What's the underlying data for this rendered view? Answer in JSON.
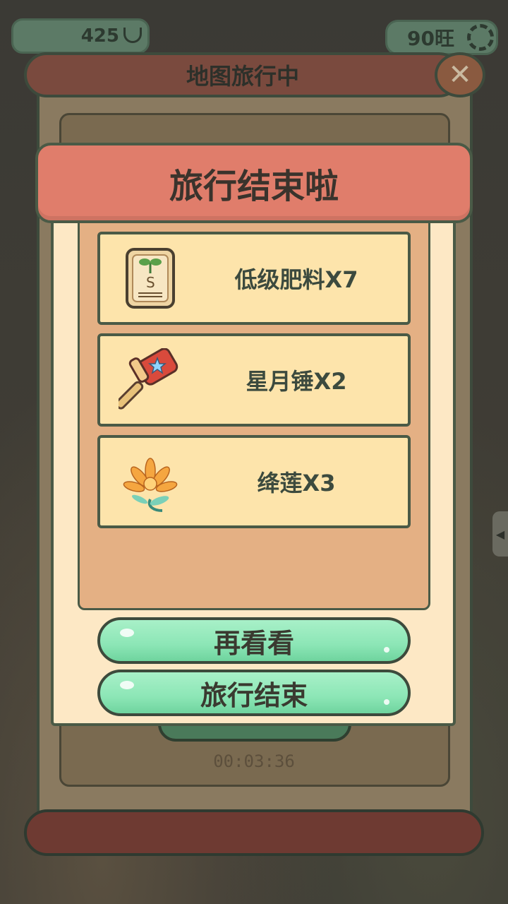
{
  "hud": {
    "currency_value": "425",
    "currency_icon": "ingot-icon",
    "prosperity_value": "90旺",
    "settings_icon": "gear-icon"
  },
  "map_panel": {
    "title": "地图旅行中",
    "close_label": "✕",
    "timer": "00:03:36"
  },
  "result_dialog": {
    "title": "旅行结束啦",
    "rewards": [
      {
        "name": "低级肥料X7",
        "icon": "fertilizer-bag-icon"
      },
      {
        "name": "星月锤X2",
        "icon": "star-moon-hammer-icon"
      },
      {
        "name": "绛莲X3",
        "icon": "crimson-lotus-icon"
      }
    ],
    "buttons": {
      "look_again": "再看看",
      "end_travel": "旅行结束"
    }
  },
  "colors": {
    "header": "#e07d6b",
    "dialog_bg": "#fde8c5",
    "reward_bg": "#fde4ab",
    "button_green": "#8ce6b6",
    "outline": "#4a5a46"
  }
}
